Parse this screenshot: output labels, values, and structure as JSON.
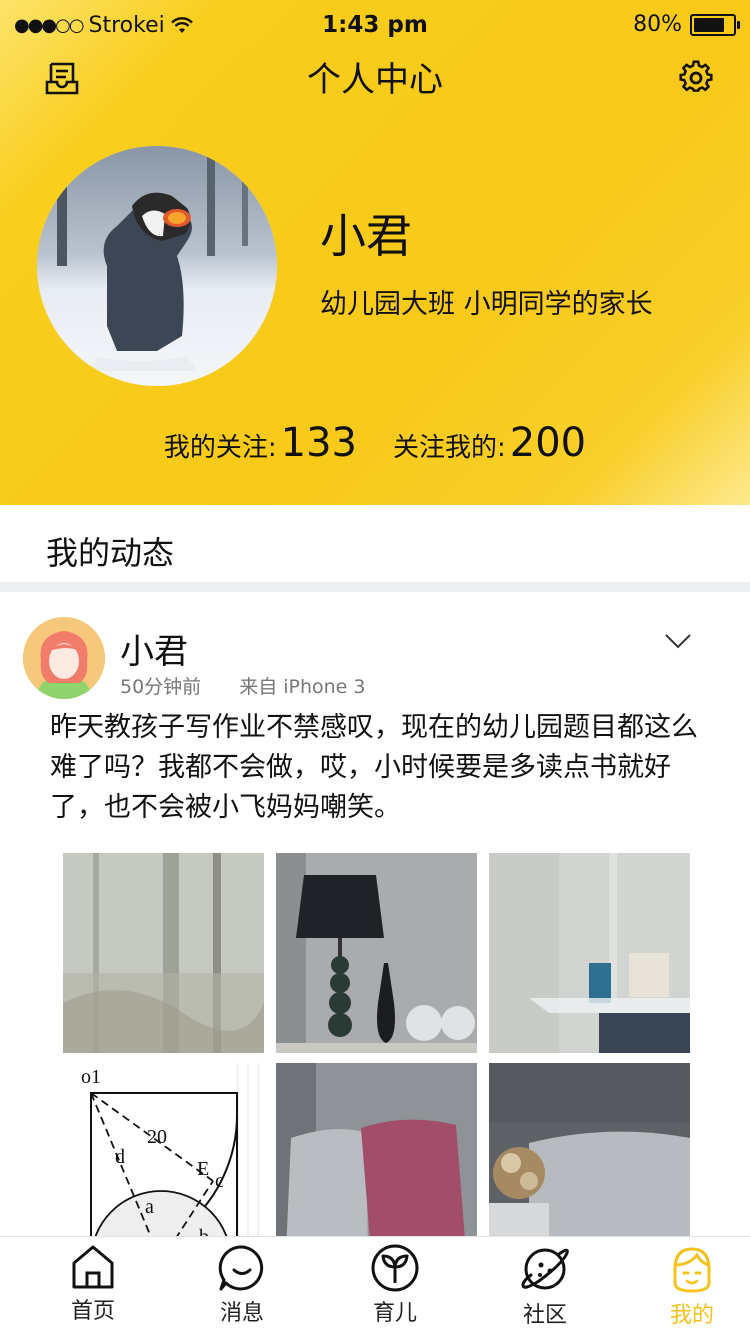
{
  "status_bar": {
    "carrier": "Strokei",
    "time": "1:43 pm",
    "battery_percent": "80%",
    "battery_level": 0.8
  },
  "nav": {
    "title": "个人中心",
    "left_icon": "notes-icon",
    "right_icon": "gear-icon"
  },
  "profile": {
    "name": "小君",
    "description": "幼儿园大班 小明同学的家长",
    "following_label": "我的关注:",
    "following_count": "133",
    "followers_label": "关注我的:",
    "followers_count": "200"
  },
  "section": {
    "title": "我的动态"
  },
  "post": {
    "author": "小君",
    "time": "50分钟前",
    "source": "来自 iPhone 3",
    "text": "昨天教孩子写作业不禁感叹，现在的幼儿园题目都这么难了吗？我都不会做，哎，小时候要是多读点书就好了，也不会被小飞妈妈嘲笑。",
    "images": [
      {
        "name": "forest-photo"
      },
      {
        "name": "lamp-photo"
      },
      {
        "name": "table-photo"
      },
      {
        "name": "geometry-diagram-photo",
        "labels": [
          "o1",
          "20",
          "d",
          "E",
          "c",
          "a",
          "b"
        ]
      },
      {
        "name": "pillow-photo"
      },
      {
        "name": "sofa-photo"
      }
    ]
  },
  "tabs": [
    {
      "label": "首页",
      "icon": "home-icon"
    },
    {
      "label": "消息",
      "icon": "chat-icon"
    },
    {
      "label": "育儿",
      "icon": "sprout-icon"
    },
    {
      "label": "社区",
      "icon": "planet-icon"
    },
    {
      "label": "我的",
      "icon": "face-icon",
      "active": true
    }
  ],
  "colors": {
    "accent": "#f8c919",
    "active_tab": "#f4c21a"
  }
}
